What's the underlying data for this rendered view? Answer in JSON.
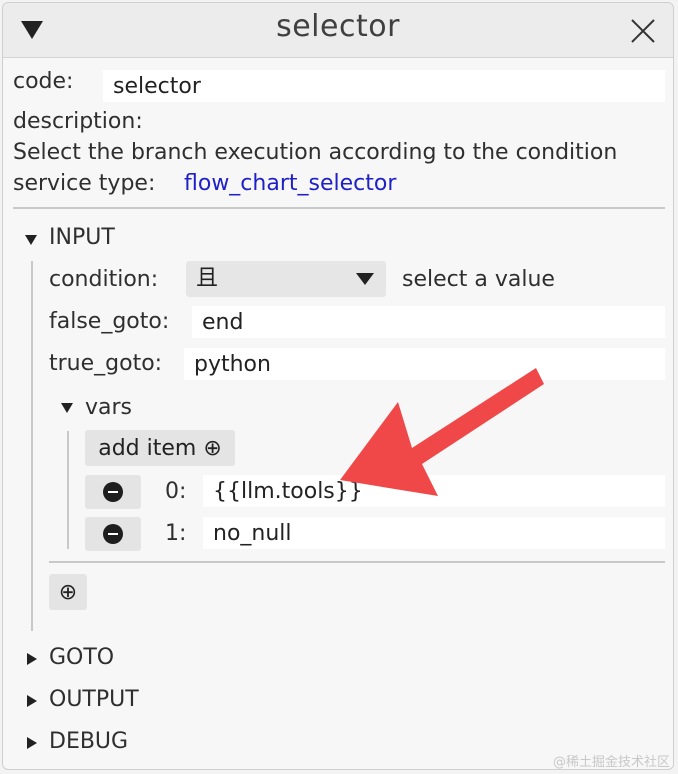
{
  "window": {
    "title": "selector",
    "collapse_icon": "triangle-down-icon",
    "close_icon": "close-icon"
  },
  "header": {
    "code_label": "code:",
    "code_value": "selector",
    "description_label": "description:",
    "description_text": "Select the branch execution according to the condition",
    "service_type_label": "service type:",
    "service_type_value": "flow_chart_selector"
  },
  "input_section": {
    "label": "INPUT",
    "condition_label": "condition:",
    "condition_value": "且",
    "condition_hint": "select a value",
    "false_goto_label": "false_goto:",
    "false_goto_value": "end",
    "true_goto_label": "true_goto:",
    "true_goto_value": "python",
    "vars": {
      "label": "vars",
      "add_item_label": "add item ⊕",
      "items": [
        {
          "index": "0:",
          "value": "{{llm.tools}}"
        },
        {
          "index": "1:",
          "value": "no_null"
        }
      ]
    },
    "add_field_label": "⊕"
  },
  "sections": {
    "goto": "GOTO",
    "output": "OUTPUT",
    "debug": "DEBUG"
  },
  "annotation": {
    "arrow_color": "#f04848"
  },
  "watermark": "@稀土掘金技术社区"
}
